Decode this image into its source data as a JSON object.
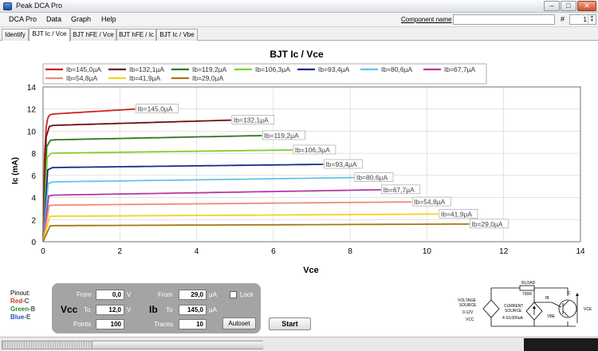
{
  "window": {
    "title": "Peak DCA Pro",
    "min": "–",
    "max": "□",
    "close": "✕"
  },
  "menu": {
    "items": [
      "DCA Pro",
      "Data",
      "Graph",
      "Help"
    ]
  },
  "component": {
    "label": "Component name",
    "value": "",
    "hash_label": "#",
    "number": "1"
  },
  "tabs": [
    "Identify",
    "BJT Ic / Vce",
    "BJT hFE / Vce",
    "BJT hFE / Ic",
    "BJT Ic / Vbe"
  ],
  "active_tab": 1,
  "chart_data": {
    "type": "line",
    "title": "BJT Ic / Vce",
    "xlabel": "Vce",
    "ylabel": "Ic (mA)",
    "xlim": [
      0,
      14
    ],
    "ylim": [
      0,
      14
    ],
    "xticks": [
      0,
      2,
      4,
      6,
      8,
      10,
      12,
      14
    ],
    "yticks": [
      0,
      2,
      4,
      6,
      8,
      10,
      12,
      14
    ],
    "grid": true,
    "legend": "top",
    "series": [
      {
        "name": "Ib=145,0µA",
        "color": "#cc2222",
        "vce_end": 2.4,
        "sat": 11.5,
        "ic_end": 12.0
      },
      {
        "name": "Ib=132,1µA",
        "color": "#6e0f0f",
        "vce_end": 4.9,
        "sat": 10.5,
        "ic_end": 11.0
      },
      {
        "name": "Ib=119,2µA",
        "color": "#2a7a1c",
        "vce_end": 5.7,
        "sat": 9.2,
        "ic_end": 9.6
      },
      {
        "name": "Ib=106,3µA",
        "color": "#7bd12e",
        "vce_end": 6.5,
        "sat": 8.0,
        "ic_end": 8.3
      },
      {
        "name": "Ib=93,4µA",
        "color": "#1a2a8c",
        "vce_end": 7.3,
        "sat": 6.7,
        "ic_end": 7.0
      },
      {
        "name": "Ib=80,6µA",
        "color": "#66c2ea",
        "vce_end": 8.1,
        "sat": 5.4,
        "ic_end": 5.8
      },
      {
        "name": "Ib=67,7µA",
        "color": "#b13aa5",
        "vce_end": 8.8,
        "sat": 4.2,
        "ic_end": 4.7
      },
      {
        "name": "Ib=54,8µA",
        "color": "#f08a7a",
        "vce_end": 9.6,
        "sat": 3.3,
        "ic_end": 3.6
      },
      {
        "name": "Ib=41,9µA",
        "color": "#f4d21f",
        "vce_end": 10.3,
        "sat": 2.3,
        "ic_end": 2.5
      },
      {
        "name": "Ib=29,0µA",
        "color": "#a07a10",
        "vce_end": 11.1,
        "sat": 1.45,
        "ic_end": 1.6
      }
    ]
  },
  "pinout": {
    "title": "Pinout:",
    "red": "Red",
    "red_pin": "-C",
    "green": "Green",
    "green_pin": "-B",
    "blue": "Blue",
    "blue_pin": "-E"
  },
  "controls": {
    "vcc": {
      "label": "Vcc",
      "from_label": "From",
      "from": "0,0",
      "to_label": "To",
      "to": "12,0",
      "unit": "V",
      "points_label": "Points",
      "points": "100"
    },
    "ib": {
      "label": "Ib",
      "from_label": "From",
      "from": "29,0",
      "to_label": "To",
      "to": "145,0",
      "unit": "µA",
      "traces_label": "Traces",
      "traces": "10"
    },
    "lock": "Lock",
    "autoset": "Autoset",
    "start": "Start"
  },
  "circuit": {
    "rload": "RLOAD",
    "rload_value": "700R",
    "voltage_source_1": "VOLTAGE",
    "voltage_source_2": "SOURCE",
    "voltage_range": "0-12V",
    "vcc": "VCC",
    "current_source_1": "CURRENT",
    "current_source_2": "SOURCE",
    "current_range": "4-10,000uA",
    "ib": "IB",
    "vbe": "VBE",
    "vce": "VCE",
    "c": "C"
  }
}
